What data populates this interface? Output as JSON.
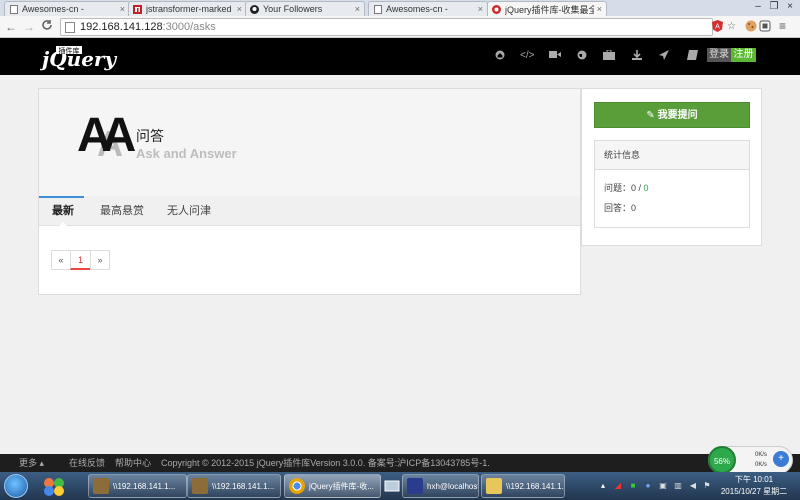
{
  "browser": {
    "tabs": [
      {
        "label": "Awesomes-cn -",
        "active": false,
        "icon": "page-icon"
      },
      {
        "label": "jstransformer-marked",
        "active": false,
        "icon": "npm-icon"
      },
      {
        "label": "Your Followers",
        "active": false,
        "icon": "github-icon"
      },
      {
        "label": "Awesomes-cn -",
        "active": false,
        "icon": "page-icon"
      },
      {
        "label": "jQuery插件库-收集最全最",
        "active": true,
        "icon": "jquery-icon"
      }
    ],
    "url_host": "192.168.141.128",
    "url_path": ":3000/asks",
    "back": "←",
    "forward": "→",
    "reload": "C",
    "ext_star": "☆",
    "menu": "≡"
  },
  "header": {
    "logo_text": "jQuery",
    "logo_sub": "插件库",
    "icons": [
      "home-icon",
      "code-icon",
      "video-icon",
      "globe-icon",
      "briefcase-icon",
      "download-icon",
      "rocket-icon",
      "book-icon"
    ],
    "login_label": "登录",
    "register_label": "注册"
  },
  "hero": {
    "logo_letters": "AA",
    "title": "问答",
    "subtitle": "Ask and Answer"
  },
  "tabs": [
    "最新",
    "最高悬赏",
    "无人问津"
  ],
  "pagination": {
    "prev": "«",
    "current": "1",
    "next": "»"
  },
  "sidebar": {
    "ask_button": "✎ 我要提问",
    "stats_title": "统计信息",
    "questions_label": "问题：",
    "questions_value": "0",
    "questions_sep": " / ",
    "questions_value2": "0",
    "answers_label": "回答：",
    "answers_value": "0"
  },
  "footer": {
    "more": "更多 ▴",
    "feedback": "在线反馈",
    "help": "帮助中心",
    "copyright": "Copyright © 2012-2015 jQuery插件库Version 3.0.0. 备案号:沪ICP备13043785号-1."
  },
  "speed_widget": {
    "percent": "56%",
    "up": "0K/s",
    "down": "0K/s",
    "plus": "+"
  },
  "taskbar": {
    "tasks": [
      {
        "label": "\\\\192.168.141.1...",
        "icon_color": "#8c6d3a"
      },
      {
        "label": "\\\\192.168.141.1...",
        "icon_color": "#8c6d3a"
      },
      {
        "label": "jQuery插件库-收...",
        "icon_color": "#e6a400"
      },
      {
        "label": "hxh@localhost: ...",
        "icon_color": "#2b3c8f"
      },
      {
        "label": "\\\\192.168.141.1...",
        "icon_color": "#e7c65b"
      }
    ],
    "time": "下午 10:01",
    "date": "2015/10/27 星期二"
  }
}
